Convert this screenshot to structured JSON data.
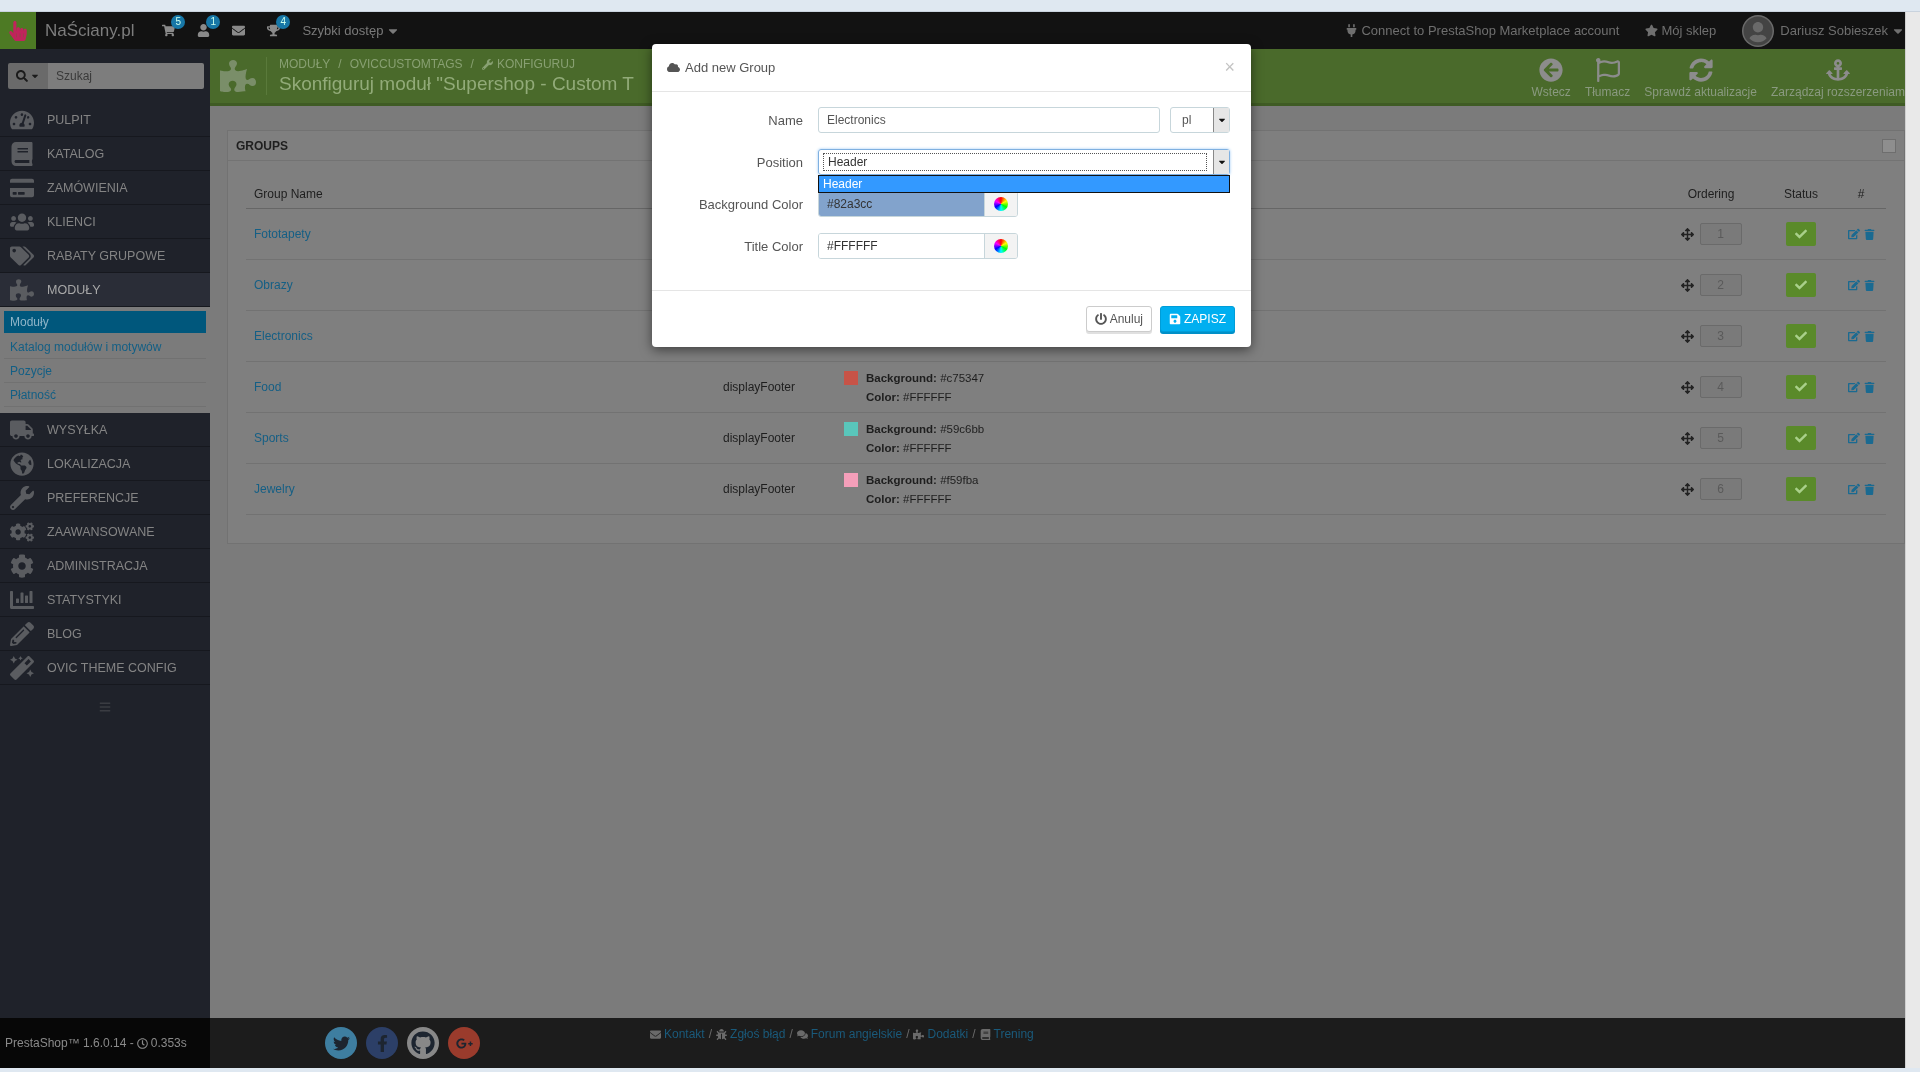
{
  "topbar": {
    "shop_name": "NaŚciany.pl",
    "notifications": [
      {
        "kind": "cart",
        "badge": "5"
      },
      {
        "kind": "customers",
        "badge": "1"
      },
      {
        "kind": "messages"
      },
      {
        "kind": "trophy",
        "badge": "4"
      }
    ],
    "quick_access": "Szybki dostęp",
    "marketplace_link": "Connect to PrestaShop Marketplace account",
    "my_shop": "Mój sklep",
    "user_name": "Dariusz Sobieszek"
  },
  "sidebar": {
    "search_placeholder": "Szukaj",
    "items": [
      {
        "label": "PULPIT",
        "expanded": false
      },
      {
        "label": "KATALOG",
        "expanded": false
      },
      {
        "label": "ZAMÓWIENIA",
        "expanded": false
      },
      {
        "label": "KLIENCI",
        "expanded": false
      },
      {
        "label": "RABATY GRUPOWE",
        "expanded": false
      },
      {
        "label": "MODUŁY",
        "expanded": true,
        "children": [
          {
            "label": "Moduły",
            "selected": true
          },
          {
            "label": "Katalog modułów i motywów",
            "selected": false
          },
          {
            "label": "Pozycje",
            "selected": false
          },
          {
            "label": "Płatność",
            "selected": false
          }
        ]
      },
      {
        "label": "WYSYŁKA",
        "expanded": false
      },
      {
        "label": "LOKALIZACJA",
        "expanded": false
      },
      {
        "label": "PREFERENCJE",
        "expanded": false
      },
      {
        "label": "ZAAWANSOWANE",
        "expanded": false
      },
      {
        "label": "ADMINISTRACJA",
        "expanded": false
      },
      {
        "label": "STATYSTYKI",
        "expanded": false
      },
      {
        "label": "BLOG",
        "expanded": false
      },
      {
        "label": "OVIC THEME CONFIG",
        "expanded": false
      }
    ]
  },
  "page_header": {
    "breadcrumb": [
      "MODUŁY",
      "OVICCUSTOMTAGS",
      "KONFIGURUJ"
    ],
    "separator": "/",
    "title": "Skonfiguruj moduł \"Supershop - Custom T",
    "toolbar": [
      "Wstecz",
      "Tłumacz",
      "Sprawdź aktualizacje",
      "Zarządzaj rozszerzeniam"
    ]
  },
  "panel": {
    "title": "GROUPS",
    "columns": [
      "Group Name",
      "Ordering",
      "Status",
      "#"
    ],
    "rows": [
      {
        "name": "Fototapety",
        "ordering": "1",
        "enabled": true
      },
      {
        "name": "Obrazy",
        "ordering": "2",
        "enabled": true
      },
      {
        "name": "Electronics",
        "ordering": "3",
        "enabled": true
      },
      {
        "name": "Food",
        "position": "displayFooter",
        "background_label": "Background:",
        "background": "#c75347",
        "color_label": "Color:",
        "color_value": "#FFFFFF",
        "ordering": "4",
        "enabled": true
      },
      {
        "name": "Sports",
        "position": "displayFooter",
        "background_label": "Background:",
        "background": "#59c6bb",
        "color_label": "Color:",
        "color_value": "#FFFFFF",
        "ordering": "5",
        "enabled": true
      },
      {
        "name": "Jewelry",
        "position": "displayFooter",
        "background_label": "Background:",
        "background": "#f59fba",
        "color_label": "Color:",
        "color_value": "#FFFFFF",
        "ordering": "6",
        "enabled": true
      }
    ]
  },
  "modal": {
    "title": "Add new Group",
    "close": "×",
    "fields": [
      {
        "kind": "text",
        "label": "Name",
        "value": "Electronics",
        "language": "pl"
      },
      {
        "kind": "select",
        "label": "Position",
        "value": "Header",
        "expanded": true,
        "options": [
          {
            "label": "Header",
            "selected": true
          }
        ]
      },
      {
        "kind": "color",
        "label": "Background Color",
        "value": "#82a3cc"
      },
      {
        "kind": "color",
        "label": "Title Color",
        "value": "#FFFFFF"
      }
    ],
    "buttons": [
      {
        "kind": "cancel",
        "label": "Anuluj"
      },
      {
        "kind": "save",
        "label": "ZAPISZ"
      }
    ]
  },
  "footer": {
    "version": "PrestaShop™ 1.6.0.14 -",
    "time": "0.353s",
    "links": [
      "Kontakt",
      "Zgłoś błąd",
      "Forum angielskie",
      "Dodatki",
      "Trening"
    ],
    "separator": "/"
  }
}
